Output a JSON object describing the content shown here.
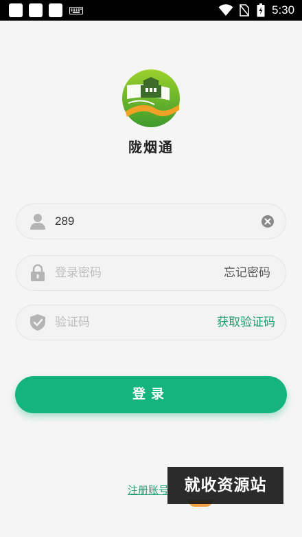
{
  "status_bar": {
    "time": "5:30",
    "icons": [
      "notification-box-icon",
      "notification-box-icon",
      "notification-box-icon",
      "keyboard-icon",
      "wifi-icon",
      "no-sim-icon",
      "battery-charging-icon"
    ]
  },
  "app": {
    "name": "陇烟通",
    "logo_icon": "app-logo-icon"
  },
  "login_form": {
    "account": {
      "value": "289",
      "icon": "user-icon",
      "clear_icon": "clear-icon"
    },
    "password": {
      "placeholder": "登录密码",
      "icon": "lock-icon",
      "forgot_label": "忘记密码"
    },
    "code": {
      "placeholder": "验证码",
      "icon": "shield-check-icon",
      "get_code_label": "获取验证码"
    },
    "login_label": "登录",
    "register_label": "注册账号"
  },
  "watermark": "就收资源站",
  "colors": {
    "accent": "#15b47e",
    "accent_text": "#1a9e6e",
    "background": "#f5f5f5"
  }
}
